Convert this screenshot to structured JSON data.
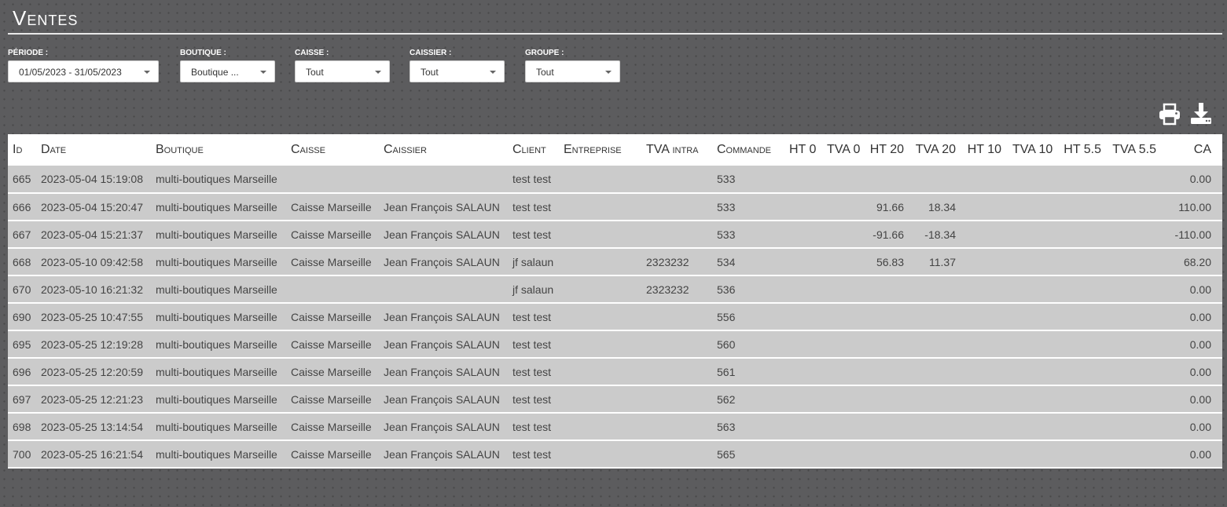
{
  "page": {
    "title": "Ventes"
  },
  "filters": [
    {
      "label": "PÉRIODE :",
      "value": "01/05/2023 - 31/05/2023",
      "name": "periode"
    },
    {
      "label": "BOUTIQUE :",
      "value": "Boutique ...",
      "name": "boutique"
    },
    {
      "label": "CAISSE :",
      "value": "Tout",
      "name": "caisse"
    },
    {
      "label": "CAISSIER :",
      "value": "Tout",
      "name": "caissier"
    },
    {
      "label": "GROUPE :",
      "value": "Tout",
      "name": "groupe"
    }
  ],
  "actions": [
    {
      "name": "print-icon"
    },
    {
      "name": "download-icon"
    }
  ],
  "table": {
    "headers": [
      "Id",
      "Date",
      "Boutique",
      "Caisse",
      "Caissier",
      "Client",
      "Entreprise",
      "TVA intra",
      "Commande",
      "HT 0",
      "TVA 0",
      "HT 20",
      "TVA 20",
      "HT 10",
      "TVA 10",
      "HT 5.5",
      "TVA 5.5",
      "CA"
    ],
    "rows": [
      [
        "665",
        "2023-05-04 15:19:08",
        "multi-boutiques Marseille",
        "",
        "",
        "test test",
        "",
        "",
        "533",
        "",
        "",
        "",
        "",
        "",
        "",
        "",
        "",
        "0.00"
      ],
      [
        "666",
        "2023-05-04 15:20:47",
        "multi-boutiques Marseille",
        "Caisse Marseille",
        "Jean François SALAUN",
        "test test",
        "",
        "",
        "533",
        "",
        "",
        "91.66",
        "18.34",
        "",
        "",
        "",
        "",
        "110.00"
      ],
      [
        "667",
        "2023-05-04 15:21:37",
        "multi-boutiques Marseille",
        "Caisse Marseille",
        "Jean François SALAUN",
        "test test",
        "",
        "",
        "533",
        "",
        "",
        "-91.66",
        "-18.34",
        "",
        "",
        "",
        "",
        "-110.00"
      ],
      [
        "668",
        "2023-05-10 09:42:58",
        "multi-boutiques Marseille",
        "Caisse Marseille",
        "Jean François SALAUN",
        "jf salaun",
        "",
        "2323232",
        "534",
        "",
        "",
        "56.83",
        "11.37",
        "",
        "",
        "",
        "",
        "68.20"
      ],
      [
        "670",
        "2023-05-10 16:21:32",
        "multi-boutiques Marseille",
        "",
        "",
        "jf salaun",
        "",
        "2323232",
        "536",
        "",
        "",
        "",
        "",
        "",
        "",
        "",
        "",
        "0.00"
      ],
      [
        "690",
        "2023-05-25 10:47:55",
        "multi-boutiques Marseille",
        "Caisse Marseille",
        "Jean François SALAUN",
        "test test",
        "",
        "",
        "556",
        "",
        "",
        "",
        "",
        "",
        "",
        "",
        "",
        "0.00"
      ],
      [
        "695",
        "2023-05-25 12:19:28",
        "multi-boutiques Marseille",
        "Caisse Marseille",
        "Jean François SALAUN",
        "test test",
        "",
        "",
        "560",
        "",
        "",
        "",
        "",
        "",
        "",
        "",
        "",
        "0.00"
      ],
      [
        "696",
        "2023-05-25 12:20:59",
        "multi-boutiques Marseille",
        "Caisse Marseille",
        "Jean François SALAUN",
        "test test",
        "",
        "",
        "561",
        "",
        "",
        "",
        "",
        "",
        "",
        "",
        "",
        "0.00"
      ],
      [
        "697",
        "2023-05-25 12:21:23",
        "multi-boutiques Marseille",
        "Caisse Marseille",
        "Jean François SALAUN",
        "test test",
        "",
        "",
        "562",
        "",
        "",
        "",
        "",
        "",
        "",
        "",
        "",
        "0.00"
      ],
      [
        "698",
        "2023-05-25 13:14:54",
        "multi-boutiques Marseille",
        "Caisse Marseille",
        "Jean François SALAUN",
        "test test",
        "",
        "",
        "563",
        "",
        "",
        "",
        "",
        "",
        "",
        "",
        "",
        "0.00"
      ],
      [
        "700",
        "2023-05-25 16:21:54",
        "multi-boutiques Marseille",
        "Caisse Marseille",
        "Jean François SALAUN",
        "test test",
        "",
        "",
        "565",
        "",
        "",
        "",
        "",
        "",
        "",
        "",
        "",
        "0.00"
      ]
    ]
  }
}
